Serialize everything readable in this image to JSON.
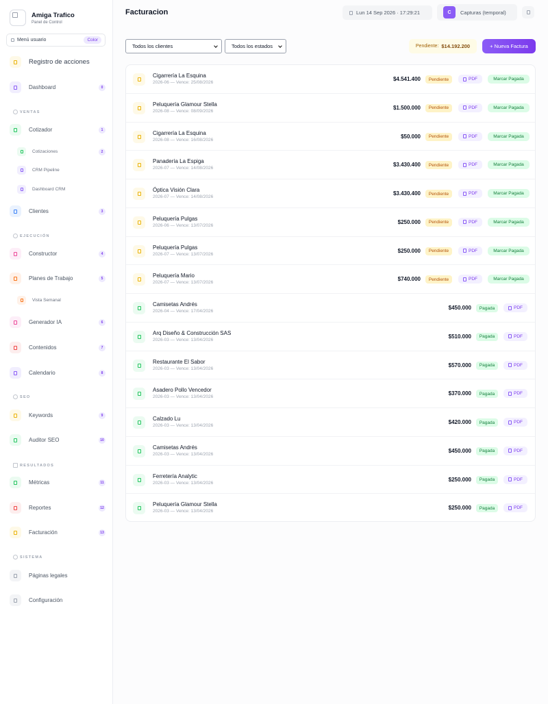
{
  "brand": {
    "title": "Amiga Trafico",
    "subtitle": "Panel de Control"
  },
  "menu_bar": {
    "label": "Menú usuario",
    "chip": "Color"
  },
  "sidebar": {
    "registro": {
      "label": "Registro de acciones"
    },
    "dashboard": {
      "label": "Dashboard",
      "badge": "0"
    },
    "ventas_section": "VENTAS",
    "cotizador": {
      "label": "Cotizador",
      "badge": "1"
    },
    "cotizaciones": {
      "label": "Cotizaciones",
      "badge": "2"
    },
    "crm_pipeline": {
      "label": "CRM Pipeline"
    },
    "dashboard_crm": {
      "label": "Dashboard CRM"
    },
    "clientes": {
      "label": "Clientes",
      "badge": "3"
    },
    "ejecucion_section": "EJECUCIÓN",
    "constructor": {
      "label": "Constructor",
      "badge": "4"
    },
    "planes": {
      "label": "Planes de Trabajo",
      "badge": "5"
    },
    "vista_semanal": {
      "label": "Vista Semanal"
    },
    "generador": {
      "label": "Generador IA",
      "badge": "6"
    },
    "contenidos": {
      "label": "Contenidos",
      "badge": "7"
    },
    "calendario": {
      "label": "Calendario",
      "badge": "8"
    },
    "seo_section": "SEO",
    "keywords": {
      "label": "Keywords",
      "badge": "9"
    },
    "auditor": {
      "label": "Auditor SEO",
      "badge": "10"
    },
    "resultados_section": "RESULTADOS",
    "metricas": {
      "label": "Métricas",
      "badge": "11"
    },
    "reportes": {
      "label": "Reportes",
      "badge": "12"
    },
    "facturacion": {
      "label": "Facturación",
      "badge": "13"
    },
    "sistema_section": "SISTEMA",
    "paginas_legales": {
      "label": "Páginas legales"
    },
    "configuracion": {
      "label": "Configuración"
    }
  },
  "header": {
    "title": "Facturacion",
    "datetime": "Lun 14 Sep 2026 · 17:29:21",
    "user_initial": "C",
    "user_label": "Capturas (temporal)"
  },
  "filters": {
    "clients": "Todos los clientes",
    "states": "Todos los estados"
  },
  "summary": {
    "pending_label": "Pendiente:",
    "pending_amount": "$14.192.200"
  },
  "new_invoice_label": "+ Nueva Factura",
  "labels": {
    "pdf": "PDF",
    "mark_paid": "Marcar Pagada",
    "pending": "Pendiente",
    "paid": "Pagada"
  },
  "invoices": [
    {
      "client": "Cigarrería La Esquina",
      "meta": "2026-06 — Vence: 25/08/2026",
      "amount": "$4.541.400",
      "status": "Pendiente"
    },
    {
      "client": "Peluquería Glamour Stella",
      "meta": "2026-08 — Vence: 08/09/2026",
      "amount": "$1.500.000",
      "status": "Pendiente"
    },
    {
      "client": "Cigarrería La Esquina",
      "meta": "2026-08 — Vence: 16/08/2026",
      "amount": "$50.000",
      "status": "Pendiente"
    },
    {
      "client": "Panadería La Espiga",
      "meta": "2026-07 — Vence: 14/08/2026",
      "amount": "$3.430.400",
      "status": "Pendiente"
    },
    {
      "client": "Óptica Visión Clara",
      "meta": "2026-07 — Vence: 14/08/2026",
      "amount": "$3.430.400",
      "status": "Pendiente"
    },
    {
      "client": "Peluquería Pulgas",
      "meta": "2026-06 — Vence: 13/07/2026",
      "amount": "$250.000",
      "status": "Pendiente"
    },
    {
      "client": "Peluquería Pulgas",
      "meta": "2026-07 — Vence: 13/07/2026",
      "amount": "$250.000",
      "status": "Pendiente"
    },
    {
      "client": "Peluquería Mario",
      "meta": "2026-07 — Vence: 13/07/2026",
      "amount": "$740.000",
      "status": "Pendiente"
    },
    {
      "client": "Camisetas Andrés",
      "meta": "2026-04 — Vence: 17/04/2026",
      "amount": "$450.000",
      "status": "Pagada"
    },
    {
      "client": "Arq Diseño & Construcción SAS",
      "meta": "2026-03 — Vence: 13/04/2026",
      "amount": "$510.000",
      "status": "Pagada"
    },
    {
      "client": "Restaurante El Sabor",
      "meta": "2026-03 — Vence: 13/04/2026",
      "amount": "$570.000",
      "status": "Pagada"
    },
    {
      "client": "Asadero Pollo Vencedor",
      "meta": "2026-03 — Vence: 13/04/2026",
      "amount": "$370.000",
      "status": "Pagada"
    },
    {
      "client": "Calzado Lu",
      "meta": "2026-03 — Vence: 13/04/2026",
      "amount": "$420.000",
      "status": "Pagada"
    },
    {
      "client": "Camisetas Andrés",
      "meta": "2026-03 — Vence: 13/04/2026",
      "amount": "$450.000",
      "status": "Pagada"
    },
    {
      "client": "Ferretería Analytic",
      "meta": "2026-03 — Vence: 13/04/2026",
      "amount": "$250.000",
      "status": "Pagada"
    },
    {
      "client": "Peluquería Glamour Stella",
      "meta": "2026-03 — Vence: 13/04/2026",
      "amount": "$250.000",
      "status": "Pagada"
    }
  ],
  "colors": {
    "accent": "#7c3aed",
    "pending_bg": "#fef3c7",
    "paid_bg": "#dcfce7"
  }
}
